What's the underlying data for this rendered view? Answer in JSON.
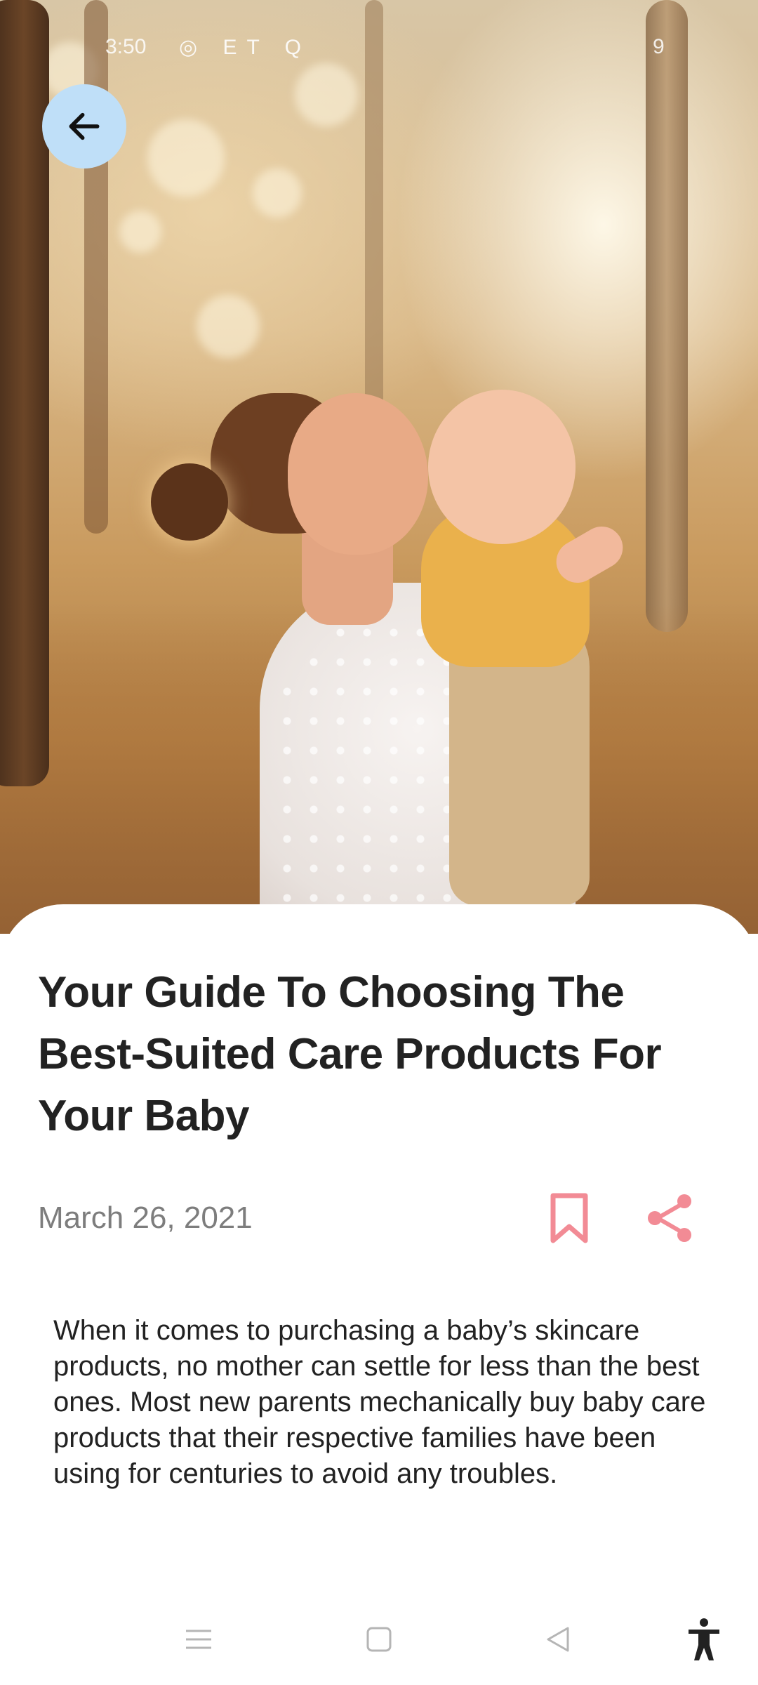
{
  "status_bar": {
    "time": "3:50",
    "icons": "◎ ET Q",
    "right": "9"
  },
  "article": {
    "title": "Your Guide To Choosing The Best-Suited Care Products For Your Baby",
    "date": "March 26, 2021",
    "body": "When it comes to purchasing a baby’s skincare products, no mother can settle for less than the best ones. Most new parents mechanically buy baby care products that their respective families have been using for centuries to avoid any troubles."
  },
  "colors": {
    "back_button_bg": "#bfdff8",
    "action_icon": "#f28b95",
    "title_text": "#222222",
    "date_text": "#7d7d7d"
  },
  "icons": {
    "back": "arrow-left-icon",
    "bookmark": "bookmark-icon",
    "share": "share-icon",
    "nav_menu": "menu-icon",
    "nav_home": "square-home-icon",
    "nav_back": "triangle-back-icon",
    "accessibility": "accessibility-icon"
  }
}
